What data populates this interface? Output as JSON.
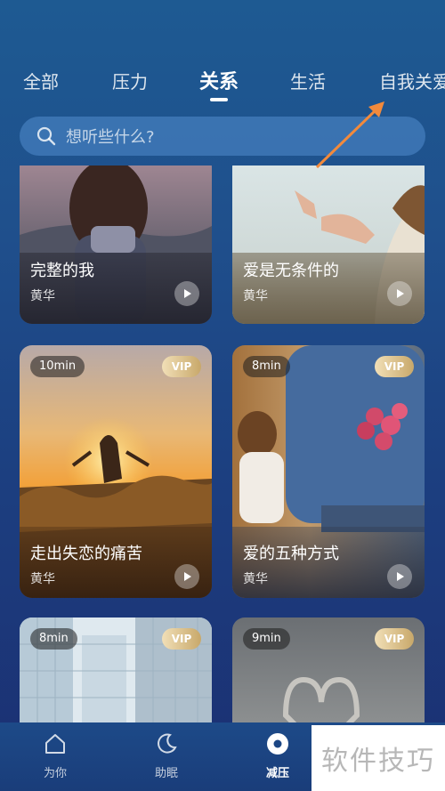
{
  "tabs": [
    "全部",
    "压力",
    "关系",
    "生活",
    "自我关爱"
  ],
  "active_tab_index": 2,
  "search": {
    "placeholder": "想听些什么?"
  },
  "cards": [
    {
      "title": "完整的我",
      "author": "黄华",
      "duration": "",
      "vip": false
    },
    {
      "title": "爱是无条件的",
      "author": "黄华",
      "duration": "",
      "vip": false
    },
    {
      "title": "走出失恋的痛苦",
      "author": "黄华",
      "duration": "10min",
      "vip": true,
      "vip_label": "VIP"
    },
    {
      "title": "爱的五种方式",
      "author": "黄华",
      "duration": "8min",
      "vip": true,
      "vip_label": "VIP"
    },
    {
      "title": "",
      "author": "",
      "duration": "8min",
      "vip": true,
      "vip_label": "VIP"
    },
    {
      "title": "",
      "author": "",
      "duration": "9min",
      "vip": true,
      "vip_label": "VIP"
    }
  ],
  "bottom_nav": [
    {
      "label": "为你",
      "icon": "home-icon"
    },
    {
      "label": "助眠",
      "icon": "moon-icon"
    },
    {
      "label": "减压",
      "icon": "target-icon",
      "active": true
    }
  ],
  "watermark": "软件技巧",
  "colors": {
    "accent_arrow": "#f28a3c",
    "vip_gold": "#c8a86a",
    "background": "#1f4f8c"
  }
}
